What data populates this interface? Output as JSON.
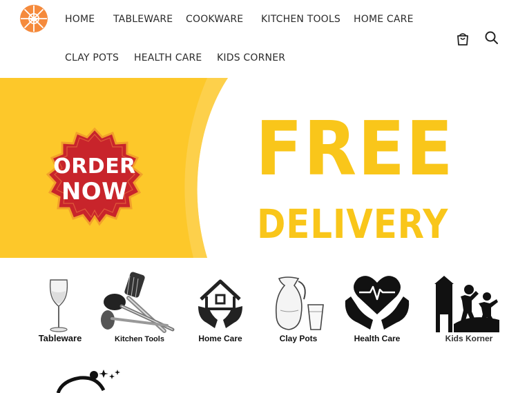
{
  "nav": {
    "items": [
      "HOME",
      "TABLEWARE",
      "COOKWARE",
      "KITCHEN TOOLS",
      "HOME CARE",
      "CLAY POTS",
      "HEALTH CARE",
      "KIDS CORNER"
    ]
  },
  "header_icons": [
    "cart-icon",
    "search-icon"
  ],
  "banner": {
    "badge_line1": "ORDER",
    "badge_line2": "NOW",
    "headline": "FREE",
    "subheadline": "DELIVERY",
    "colors": {
      "yellow": "#fdc82a",
      "badge_red": "#c8242b",
      "text_yellow": "#f9c61a"
    }
  },
  "categories": [
    {
      "label": "Tableware",
      "icon": "wine-glass-icon"
    },
    {
      "label": "Kitchen Tools",
      "icon": "kitchen-utensils-icon"
    },
    {
      "label": "Home Care",
      "icon": "home-care-icon"
    },
    {
      "label": "Clay Pots",
      "icon": "clay-pot-icon"
    },
    {
      "label": "Health Care",
      "icon": "health-care-icon"
    },
    {
      "label": "Kids Korner",
      "icon": "kids-icon"
    }
  ],
  "brand": {
    "accent": "#f58a3c"
  }
}
